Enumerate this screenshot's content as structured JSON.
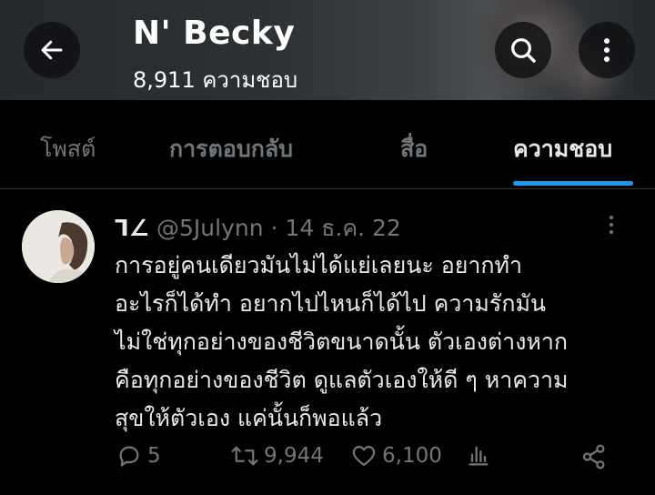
{
  "header": {
    "title": "N' Becky",
    "subtitle": "8,911 ความชอบ",
    "back_icon": "arrow-left-icon",
    "search_icon": "search-icon",
    "more_icon": "more-vertical-icon"
  },
  "tabs": [
    {
      "label": "โพสต์"
    },
    {
      "label": "การตอบกลับ"
    },
    {
      "label": "สื่อ"
    },
    {
      "label": "ความชอบ",
      "active": true
    }
  ],
  "tweet": {
    "author_name": "ᒣ∠",
    "handle_date": "@5Julynn · 14 ธ.ค. 22",
    "lines": [
      "การอยู่คนเดียวมันไม่ได้แย่เลยนะ อยากทำ",
      "อะไรก็ได้ทำ อยากไปไหนก็ได้ไป ความรักมัน",
      "ไม่ใช่ทุกอย่างของชีวิตขนาดนั้น ตัวเองต่างหาก",
      "คือทุกอย่างของชีวิต ดูแลตัวเองให้ดี ๆ หาความ",
      "สุขให้ตัวเอง แค่นั้นก็พอแล้ว"
    ],
    "replies": "5",
    "retweets": "9,944",
    "likes": "6,100"
  },
  "colors": {
    "accent": "#1d9bf0",
    "muted": "#71767b",
    "text": "#e7e9ea",
    "background": "#000000"
  }
}
